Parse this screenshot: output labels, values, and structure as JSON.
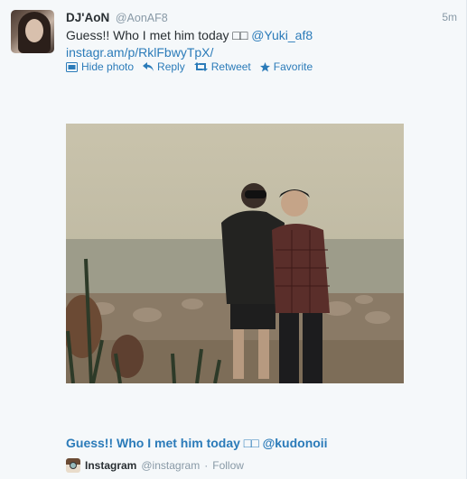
{
  "tweet": {
    "fullname": "DJ'AoN",
    "screenname": "@AonAF8",
    "time": "5m",
    "text_prefix": "Guess!! Who I met him today □□ ",
    "mention": "@Yuki_af8",
    "link": "instagr.am/p/RklFbwyTpX/"
  },
  "actions": [
    {
      "label": "Hide photo",
      "icon": "photo-icon"
    },
    {
      "label": "Reply",
      "icon": "reply-icon"
    },
    {
      "label": "Retweet",
      "icon": "retweet-icon"
    },
    {
      "label": "Favorite",
      "icon": "star-icon"
    }
  ],
  "media": {
    "caption": "Guess!! Who I met him today □□ @kudonoii",
    "app_name": "Instagram",
    "app_handle": "@instagram",
    "separator": "·",
    "follow": "Follow"
  },
  "colors": {
    "link": "#2b7bb9",
    "muted": "#8899a6",
    "text": "#292f33"
  }
}
